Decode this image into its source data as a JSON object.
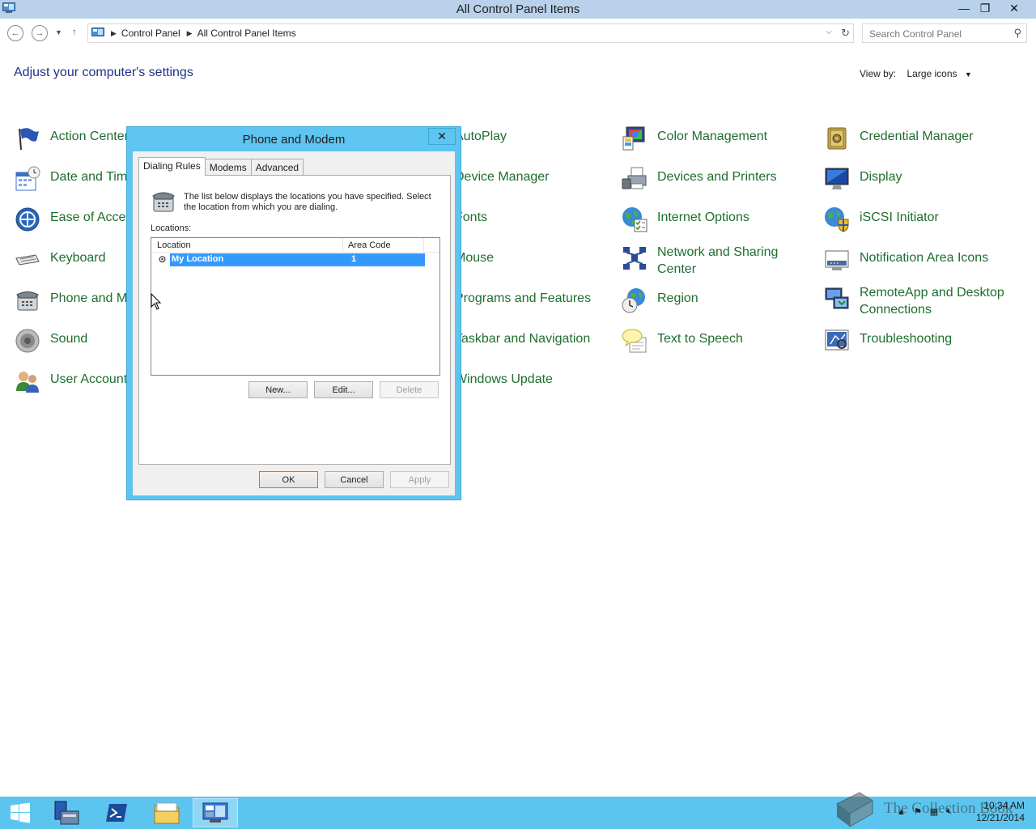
{
  "window": {
    "title": "All Control Panel Items",
    "minimize": "—",
    "restore": "❐",
    "close": "✕"
  },
  "nav": {
    "breadcrumbs": [
      "Control Panel",
      "All Control Panel Items"
    ],
    "search_placeholder": "Search Control Panel"
  },
  "main": {
    "heading": "Adjust your computer's settings",
    "view_by_label": "View by:",
    "view_by_value": "Large icons"
  },
  "items": [
    {
      "label": "Action Center",
      "icon": "flag-icon"
    },
    {
      "label": "Date and Time",
      "icon": "calendar-clock-icon"
    },
    {
      "label": "Ease of Access",
      "icon": "ease-of-access-icon"
    },
    {
      "label": "Keyboard",
      "icon": "keyboard-icon"
    },
    {
      "label": "Phone and Modem",
      "icon": "phone-modem-icon"
    },
    {
      "label": "Sound",
      "icon": "speaker-icon"
    },
    {
      "label": "User Accounts",
      "icon": "users-icon"
    },
    {
      "label": "AutoPlay",
      "icon": "autoplay-icon"
    },
    {
      "label": "Device Manager",
      "icon": "device-manager-icon"
    },
    {
      "label": "Fonts",
      "icon": "fonts-icon"
    },
    {
      "label": "Mouse",
      "icon": "mouse-icon"
    },
    {
      "label": "Programs and Features",
      "icon": "programs-icon"
    },
    {
      "label": "Taskbar and Navigation",
      "icon": "taskbar-icon"
    },
    {
      "label": "Windows Update",
      "icon": "windows-update-icon"
    },
    {
      "label": "Color Management",
      "icon": "color-management-icon"
    },
    {
      "label": "Devices and Printers",
      "icon": "printer-icon"
    },
    {
      "label": "Internet Options",
      "icon": "globe-check-icon"
    },
    {
      "label": "Network and Sharing Center",
      "icon": "network-icon"
    },
    {
      "label": "Region",
      "icon": "globe-clock-icon"
    },
    {
      "label": "Text to Speech",
      "icon": "speech-bubble-icon"
    },
    {
      "label": "Credential Manager",
      "icon": "vault-icon"
    },
    {
      "label": "Display",
      "icon": "monitor-icon"
    },
    {
      "label": "iSCSI Initiator",
      "icon": "globe-shield-icon"
    },
    {
      "label": "Notification Area Icons",
      "icon": "notification-area-icon"
    },
    {
      "label": "RemoteApp and Desktop Connections",
      "icon": "remote-desktop-icon"
    },
    {
      "label": "Troubleshooting",
      "icon": "troubleshooting-icon"
    }
  ],
  "dialog": {
    "title": "Phone and Modem",
    "close": "✕",
    "tabs": [
      "Dialing Rules",
      "Modems",
      "Advanced"
    ],
    "intro": "The list below displays the locations you have specified. Select the location from which you are dialing.",
    "locations_label": "Locations:",
    "columns": [
      "Location",
      "Area Code"
    ],
    "rows": [
      {
        "location": "My Location",
        "area_code": "1"
      }
    ],
    "buttons": {
      "new": "New...",
      "edit": "Edit...",
      "delete": "Delete",
      "ok": "OK",
      "cancel": "Cancel",
      "apply": "Apply"
    }
  },
  "taskbar": {
    "time": "10:34 AM",
    "date": "12/21/2014",
    "watermark": "The Collection Book"
  },
  "colors": {
    "link_green": "#1e6e2e",
    "heading_blue": "#1e3287",
    "dialog_frame": "#5ec4f0",
    "taskbar": "#5cc5ef",
    "selection": "#3399ff"
  }
}
